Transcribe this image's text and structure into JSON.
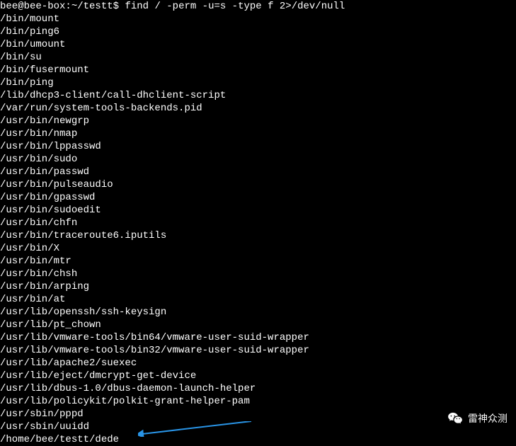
{
  "prompt": {
    "user_host": "bee@bee-box",
    "path": "~/testt",
    "separator": "$",
    "command": "find / -perm -u=s -type f 2>/dev/null"
  },
  "output": [
    "/bin/mount",
    "/bin/ping6",
    "/bin/umount",
    "/bin/su",
    "/bin/fusermount",
    "/bin/ping",
    "/lib/dhcp3-client/call-dhclient-script",
    "/var/run/system-tools-backends.pid",
    "/usr/bin/newgrp",
    "/usr/bin/nmap",
    "/usr/bin/lppasswd",
    "/usr/bin/sudo",
    "/usr/bin/passwd",
    "/usr/bin/pulseaudio",
    "/usr/bin/gpasswd",
    "/usr/bin/sudoedit",
    "/usr/bin/chfn",
    "/usr/bin/traceroute6.iputils",
    "/usr/bin/X",
    "/usr/bin/mtr",
    "/usr/bin/chsh",
    "/usr/bin/arping",
    "/usr/bin/at",
    "/usr/lib/openssh/ssh-keysign",
    "/usr/lib/pt_chown",
    "/usr/lib/vmware-tools/bin64/vmware-user-suid-wrapper",
    "/usr/lib/vmware-tools/bin32/vmware-user-suid-wrapper",
    "/usr/lib/apache2/suexec",
    "/usr/lib/eject/dmcrypt-get-device",
    "/usr/lib/dbus-1.0/dbus-daemon-launch-helper",
    "/usr/lib/policykit/polkit-grant-helper-pam",
    "/usr/sbin/pppd",
    "/usr/sbin/uuidd"
  ],
  "highlighted_line": "/home/bee/testt/dede",
  "watermark": {
    "text": "雷神众测",
    "icon": "wechat-icon"
  },
  "annotation": {
    "arrow_color": "#2994E6"
  }
}
